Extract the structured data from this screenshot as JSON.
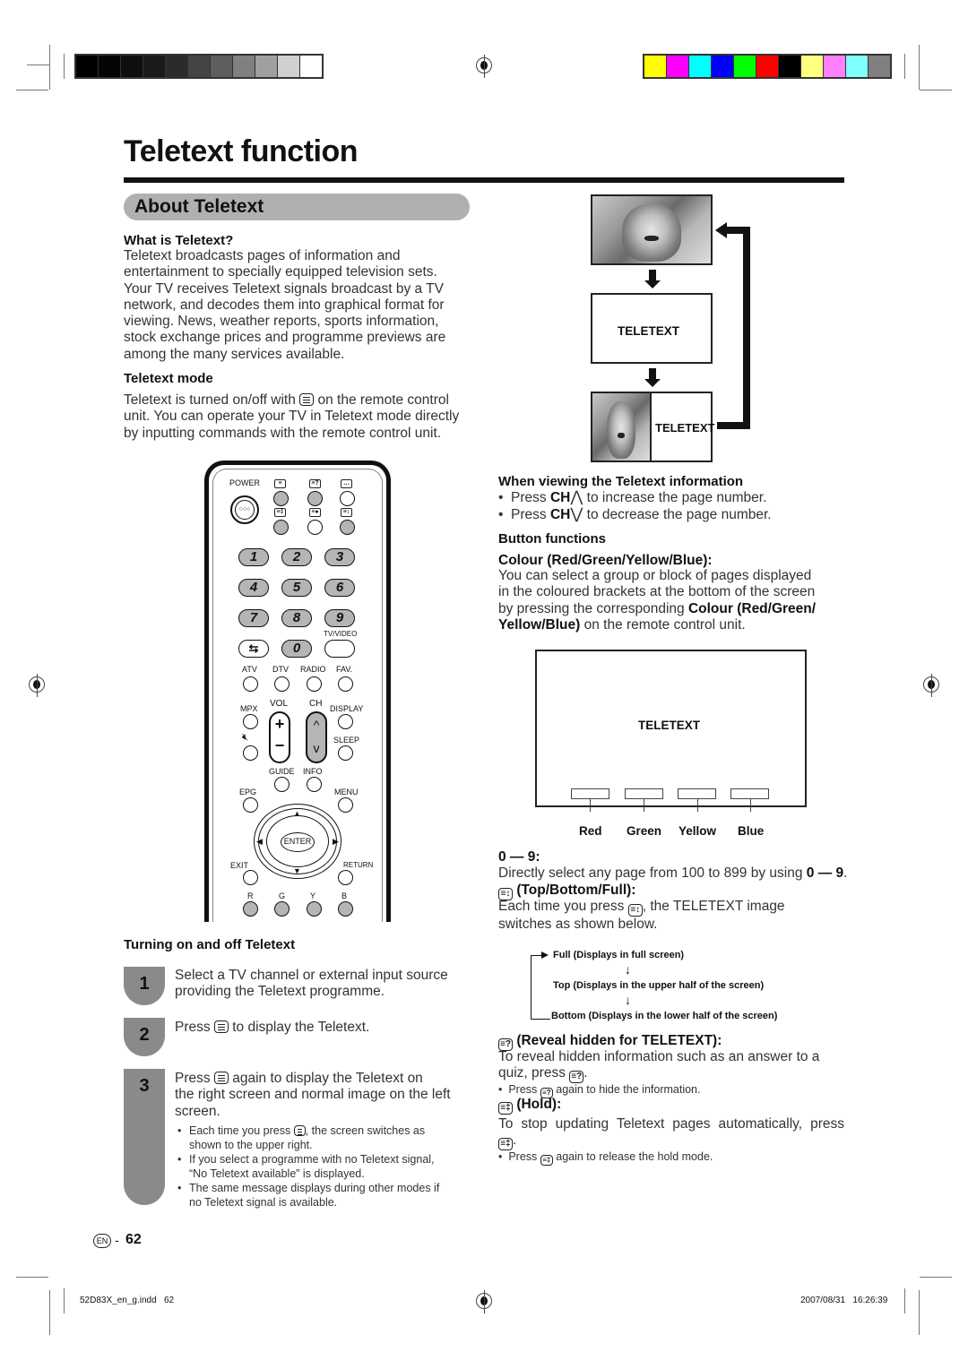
{
  "print_marks": {
    "gray_swatches": [
      "#000000",
      "#050505",
      "#0f0f0f",
      "#1a1a1a",
      "#2b2b2b",
      "#444444",
      "#5e5e5e",
      "#808080",
      "#a0a0a0",
      "#d0d0d0",
      "#ffffff"
    ],
    "color_swatches": [
      "#ffff00",
      "#ff00ff",
      "#00ffff",
      "#0000ff",
      "#00ff00",
      "#ff0000",
      "#000000",
      "#ffff80",
      "#ff80ff",
      "#80ffff",
      "#808080"
    ]
  },
  "page": {
    "title": "Teletext function",
    "section": "About Teletext"
  },
  "what_is": {
    "heading": "What is Teletext?",
    "lines": [
      "Teletext broadcasts pages of information and",
      "entertainment to specially equipped television sets.",
      "Your TV receives Teletext signals broadcast by a TV",
      "network, and decodes them into graphical format for",
      "viewing. News, weather reports, sports information,",
      "stock exchange prices and programme previews are",
      "among the many services available."
    ]
  },
  "mode": {
    "heading": "Teletext mode",
    "line1a": "Teletext is turned on/off with",
    "line1b": "on the remote control",
    "line2": "unit. You can operate your TV in Teletext mode directly",
    "line3": "by inputting commands with the remote control unit."
  },
  "diagram": {
    "label_middle": "TELETEXT",
    "label_split": "TELETEXT"
  },
  "remote": {
    "power": "POWER",
    "numbers": [
      "1",
      "2",
      "3",
      "4",
      "5",
      "6",
      "7",
      "8",
      "9",
      "0"
    ],
    "tv_video": "TV/VIDEO",
    "row_labels": [
      "ATV",
      "DTV",
      "RADIO",
      "FAV."
    ],
    "mpx": "MPX",
    "vol": "VOL",
    "ch": "CH",
    "display": "DISPLAY",
    "sleep": "SLEEP",
    "guide": "GUIDE",
    "info": "INFO",
    "epg": "EPG",
    "menu": "MENU",
    "enter": "ENTER",
    "exit": "EXIT",
    "return": "RETURN",
    "color_keys": [
      "R",
      "G",
      "Y",
      "B"
    ]
  },
  "turning": {
    "heading": "Turning on and off Teletext",
    "steps": [
      {
        "num": "1",
        "lines": [
          "Select a TV channel or external input source",
          "providing the Teletext programme."
        ]
      },
      {
        "num": "2",
        "pre": "Press",
        "post": "to display the Teletext."
      },
      {
        "num": "3",
        "pre": "Press",
        "post": "again to display the Teletext on",
        "lines": [
          "the right screen and normal image on the left",
          "screen."
        ]
      }
    ],
    "notes": [
      {
        "pre": "Each time you press",
        "post": ", the screen switches as",
        "line2": "shown to the upper right."
      },
      {
        "line1": "If you select a programme with no Teletext signal,",
        "line2": "“No Teletext available” is displayed."
      },
      {
        "line1": "The same message displays during other modes if",
        "line2": "no Teletext signal is available."
      }
    ]
  },
  "viewing": {
    "heading": "When viewing the Teletext information",
    "bullets": [
      {
        "pre": "Press",
        "key": "CH",
        "post": "to increase the page number."
      },
      {
        "pre": "Press",
        "key": "CH",
        "post": "to decrease the page number."
      }
    ]
  },
  "functions": {
    "heading": "Button functions",
    "colour_heading": "Colour (Red/Green/Yellow/Blue):",
    "colour_lines": [
      "You can select a group or block of pages displayed",
      "in the coloured  brackets at the bottom of the screen"
    ],
    "colour_line3a": "by pressing the corresponding",
    "colour_line3b": "Colour (Red/Green/",
    "colour_line4a": "Yellow/Blue)",
    "colour_line4b": "on the remote control unit.",
    "screen_label": "TELETEXT",
    "color_labels": [
      "Red",
      "Green",
      "Yellow",
      "Blue"
    ],
    "digits_heading": "0 — 9:",
    "digits_text_a": "Directly select any page from 100 to 899 by using",
    "digits_text_b": "0 — 9",
    "topbottom_heading": "(Top/Bottom/Full):",
    "topbottom_a": "Each time you press",
    "topbottom_b": ", the TELETEXT image",
    "topbottom_c": "switches as shown below.",
    "flow": [
      "Full (Displays in full screen)",
      "Top (Displays in the upper half of the screen)",
      "Bottom (Displays in the lower half of the screen)"
    ],
    "reveal_heading": "(Reveal hidden for TELETEXT):",
    "reveal_line1": "To reveal hidden information such as an answer to a",
    "reveal_line2": "quiz, press",
    "reveal_note_a": "Press",
    "reveal_note_b": "again to hide the information.",
    "hold_heading": "(Hold):",
    "hold_line1": "To stop updating Teletext pages automatically, press",
    "hold_note_a": "Press",
    "hold_note_b": "again to release the hold mode."
  },
  "footer": {
    "lang": "EN",
    "page_number": "62",
    "file": "52D83X_en_g.indd   62",
    "timestamp": "2007/08/31   16:26:39"
  }
}
